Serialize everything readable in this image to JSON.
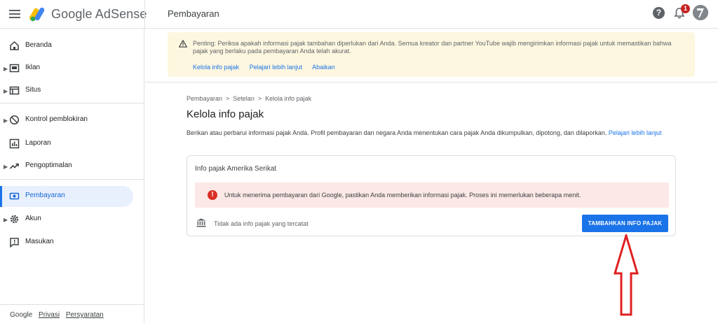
{
  "header": {
    "brand": "Google AdSense",
    "page_title": "Pembayaran",
    "notification_count": "1",
    "help_glyph": "?"
  },
  "sidebar": {
    "items": [
      {
        "label": "Beranda",
        "icon": "home-icon",
        "has_caret": false
      },
      {
        "label": "Iklan",
        "icon": "ads-icon",
        "has_caret": true
      },
      {
        "label": "Situs",
        "icon": "sites-icon",
        "has_caret": true
      },
      {
        "label": "Kontrol pemblokiran",
        "icon": "block-icon",
        "has_caret": true
      },
      {
        "label": "Laporan",
        "icon": "reports-icon",
        "has_caret": false
      },
      {
        "label": "Pengoptimalan",
        "icon": "trending-icon",
        "has_caret": true
      },
      {
        "label": "Pembayaran",
        "icon": "payments-icon",
        "has_caret": false,
        "active": true
      },
      {
        "label": "Akun",
        "icon": "gear-icon",
        "has_caret": true
      },
      {
        "label": "Masukan",
        "icon": "feedback-icon",
        "has_caret": false
      }
    ],
    "footer": {
      "brand": "Google",
      "privacy": "Privasi",
      "terms": "Persyaratan"
    }
  },
  "banner": {
    "text": "Penting: Periksa apakah informasi pajak tambahan diperlukan dari Anda. Semua kreator dan partner YouTube wajib mengirimkan informasi pajak untuk memastikan bahwa pajak yang berlaku pada pembayaran Anda telah akurat.",
    "links": {
      "manage": "Kelola info pajak",
      "learn": "Pelajari lebih lanjut",
      "dismiss": "Abaikan"
    }
  },
  "breadcrumb": {
    "items": [
      "Pembayaran",
      "Setelan",
      "Kelola info pajak"
    ],
    "separator": ">"
  },
  "main": {
    "title": "Kelola info pajak",
    "description": "Berikan atau perbarui informasi pajak Anda. Profil pembayaran dan negara Anda menentukan cara pajak Anda dikumpulkan, dipotong, dan dilaporkan.",
    "description_link": "Pelajari lebih lanjut"
  },
  "card": {
    "title": "Info pajak Amerika Serikat",
    "alert_glyph": "!",
    "alert_text": "Untuk menerima pembayaran dari Google, pastikan Anda memberikan informasi pajak. Proses ini memerlukan beberapa menit.",
    "empty_text": "Tidak ada info pajak yang tercatat",
    "add_button": "TAMBAHKAN INFO PAJAK"
  },
  "colors": {
    "accent": "#1a73e8",
    "banner_bg": "#fef7e0",
    "alert_bg": "#fce8e6",
    "error_red": "#d93025",
    "annotation_arrow": "#e02020"
  }
}
